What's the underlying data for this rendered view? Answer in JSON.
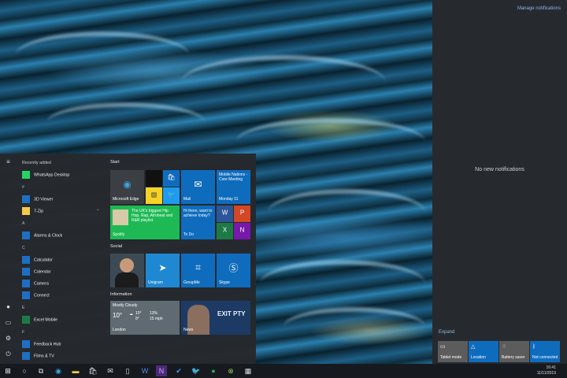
{
  "action_center": {
    "manage_notifications": "Manage notifications",
    "no_notifications": "No new notifications",
    "expand": "Expand",
    "quick_actions": [
      {
        "label": "Tablet mode",
        "icon": "tablet-icon",
        "on": false
      },
      {
        "label": "Location",
        "icon": "location-icon",
        "on": true
      },
      {
        "label": "Battery saver",
        "icon": "battery-icon",
        "on": false
      },
      {
        "label": "Not connected",
        "icon": "bluetooth-icon",
        "on": true
      }
    ]
  },
  "start": {
    "recently_added": "Recently added",
    "apps": [
      {
        "label": "WhatsApp Desktop",
        "color": "#25d366"
      },
      {
        "letter": "#"
      },
      {
        "label": "3D Viewer",
        "color": "#1e6fc2"
      },
      {
        "label": "7-Zip",
        "color": "#f2c94c",
        "chevron": "⌄"
      },
      {
        "letter": "A"
      },
      {
        "label": "Alarms & Clock",
        "color": "#1e6fc2"
      },
      {
        "letter": "C"
      },
      {
        "label": "Calculator",
        "color": "#1e6fc2"
      },
      {
        "label": "Calendar",
        "color": "#1e6fc2"
      },
      {
        "label": "Camera",
        "color": "#1e6fc2"
      },
      {
        "label": "Connect",
        "color": "#1e6fc2"
      },
      {
        "letter": "E"
      },
      {
        "label": "Excel Mobile",
        "color": "#1d7a45"
      },
      {
        "letter": "F"
      },
      {
        "label": "Feedback Hub",
        "color": "#1e6fc2"
      },
      {
        "label": "Films & TV",
        "color": "#1e6fc2"
      }
    ],
    "groups": {
      "start": "Start",
      "social": "Social",
      "information": "Information"
    },
    "tiles": {
      "edge": "Microsoft Edge",
      "mail": "Mail",
      "mobile_nations": "Mobile Nations - Core Meeting",
      "monday": "Monday 11",
      "spotify_text": "The UK's biggest Hip Hop, Rap, Afrobeat and R&B playlist.",
      "spotify": "Spotify",
      "todo_text": "Hi there, want to achieve today?",
      "todo": "To Do",
      "unigram": "Unigram",
      "groupme": "GroupMe",
      "skype": "Skype",
      "weather_cond": "Mostly Cloudy",
      "weather_temp": "10°",
      "weather_hi": "10°",
      "weather_lo": "8°",
      "weather_rain": "13%",
      "weather_wind": "15 mph",
      "weather_city": "London",
      "news": "News",
      "news_banner": "EXIT PTY"
    }
  },
  "taskbar": {
    "time": "16:41",
    "date": "11/11/2019",
    "icons": [
      "windows-icon",
      "search-icon",
      "task-view-icon",
      "edge-icon",
      "folder-icon",
      "store-icon",
      "mail-icon",
      "phone-icon",
      "word-icon",
      "onenote-icon",
      "todo-icon",
      "twitter-icon",
      "spotify-icon",
      "xbox-icon",
      "calendar-icon"
    ]
  }
}
